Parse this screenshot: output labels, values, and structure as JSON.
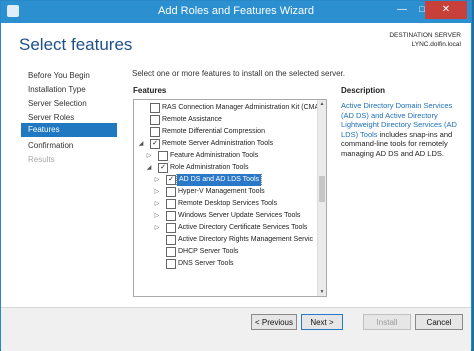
{
  "window": {
    "title": "Add Roles and Features Wizard",
    "minimize": "—",
    "maximize": "□",
    "close": "✕"
  },
  "header": {
    "page_title": "Select features",
    "destination_label": "DESTINATION SERVER",
    "destination_server": "LYNC.dolfin.local"
  },
  "nav": {
    "items": [
      {
        "label": "Before You Begin",
        "state": "normal"
      },
      {
        "label": "Installation Type",
        "state": "normal"
      },
      {
        "label": "Server Selection",
        "state": "normal"
      },
      {
        "label": "Server Roles",
        "state": "normal"
      },
      {
        "label": "Features",
        "state": "active"
      },
      {
        "label": "Confirmation",
        "state": "normal"
      },
      {
        "label": "Results",
        "state": "disabled"
      }
    ]
  },
  "main": {
    "instruction": "Select one or more features to install on the selected server.",
    "features_label": "Features",
    "description_label": "Description",
    "description_link": "Active Directory Domain Services (AD DS) and Active Directory Lightweight Directory Services (AD LDS) Tools",
    "description_rest": " includes snap-ins and command-line tools for remotely managing AD DS and AD LDS."
  },
  "tree": [
    {
      "label": "RAS Connection Manager Administration Kit (CMA",
      "checked": false,
      "expander": ""
    },
    {
      "label": "Remote Assistance",
      "checked": false,
      "expander": ""
    },
    {
      "label": "Remote Differential Compression",
      "checked": false,
      "expander": ""
    },
    {
      "label": "Remote Server Administration Tools",
      "checked": true,
      "expander": "◢"
    },
    {
      "label": "Feature Administration Tools",
      "checked": false,
      "expander": "▷"
    },
    {
      "label": "Role Administration Tools",
      "checked": true,
      "expander": "◢"
    },
    {
      "label": "AD DS and AD LDS Tools",
      "checked": true,
      "expander": "▷",
      "selected": true
    },
    {
      "label": "Hyper-V Management Tools",
      "checked": false,
      "expander": "▷"
    },
    {
      "label": "Remote Desktop Services Tools",
      "checked": false,
      "expander": "▷"
    },
    {
      "label": "Windows Server Update Services Tools",
      "checked": false,
      "expander": "▷"
    },
    {
      "label": "Active Directory Certificate Services Tools",
      "checked": false,
      "expander": "▷"
    },
    {
      "label": "Active Directory Rights Management Servic",
      "checked": false,
      "expander": ""
    },
    {
      "label": "DHCP Server Tools",
      "checked": false,
      "expander": ""
    },
    {
      "label": "DNS Server Tools",
      "checked": false,
      "expander": ""
    }
  ],
  "scroll": {
    "up": "▲",
    "down": "▼"
  },
  "footer": {
    "previous": "< Previous",
    "next": "Next >",
    "install": "Install",
    "cancel": "Cancel"
  }
}
